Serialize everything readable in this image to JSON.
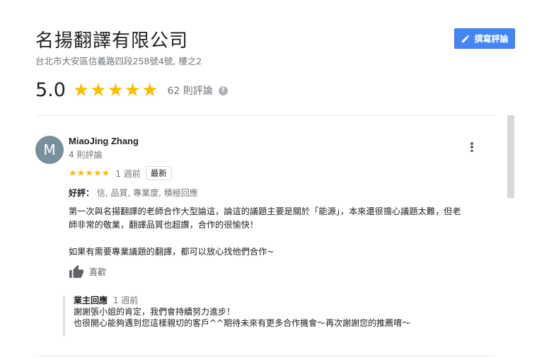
{
  "business": {
    "name": "名揚翻譯有限公司",
    "address": "台北市大安區信義路四段258號4號, 樓之2"
  },
  "write_review_label": "撰寫評論",
  "summary": {
    "rating": "5.0",
    "stars": "★★★★★",
    "count": "62 則評論",
    "help_glyph": "?"
  },
  "review": {
    "avatar_letter": "M",
    "avatar_color": "#78909c",
    "author": "MiaoJing Zhang",
    "author_reviews": "4 則評論",
    "stars": "★★★★★",
    "time": "1 週前",
    "badge": "最新",
    "attributes_label": "好評：",
    "attributes": "信, 品質, 專業度, 積極回應",
    "text_line1": "第一次與名揚翻譯的老師合作大型論這，論這的議題主要是關於「能源」，本來還很擔心議題太難，但老",
    "text_line2": "師非常的敬業，翻譯品質也超讚，合作的很愉快！",
    "text_line3": "如果有需要專業議題的翻譯，都可以放心找他們合作~",
    "like_label": "喜歡",
    "owner_reply": {
      "label": "業主回應",
      "time": "1 週前",
      "line1": "謝謝張小姐的肯定，我們會持續努力進步！",
      "line2": "也很開心能夠遇到您這樣親切的客戶^^期待未來有更多合作機會～再次謝謝您的推薦唷～"
    }
  },
  "colors": {
    "star": "#fbbc04",
    "button": "#4285f4"
  },
  "icons": {
    "write": "pencil-icon",
    "help": "help-icon",
    "more": "more-vert-icon",
    "like": "thumbs-up-icon"
  }
}
